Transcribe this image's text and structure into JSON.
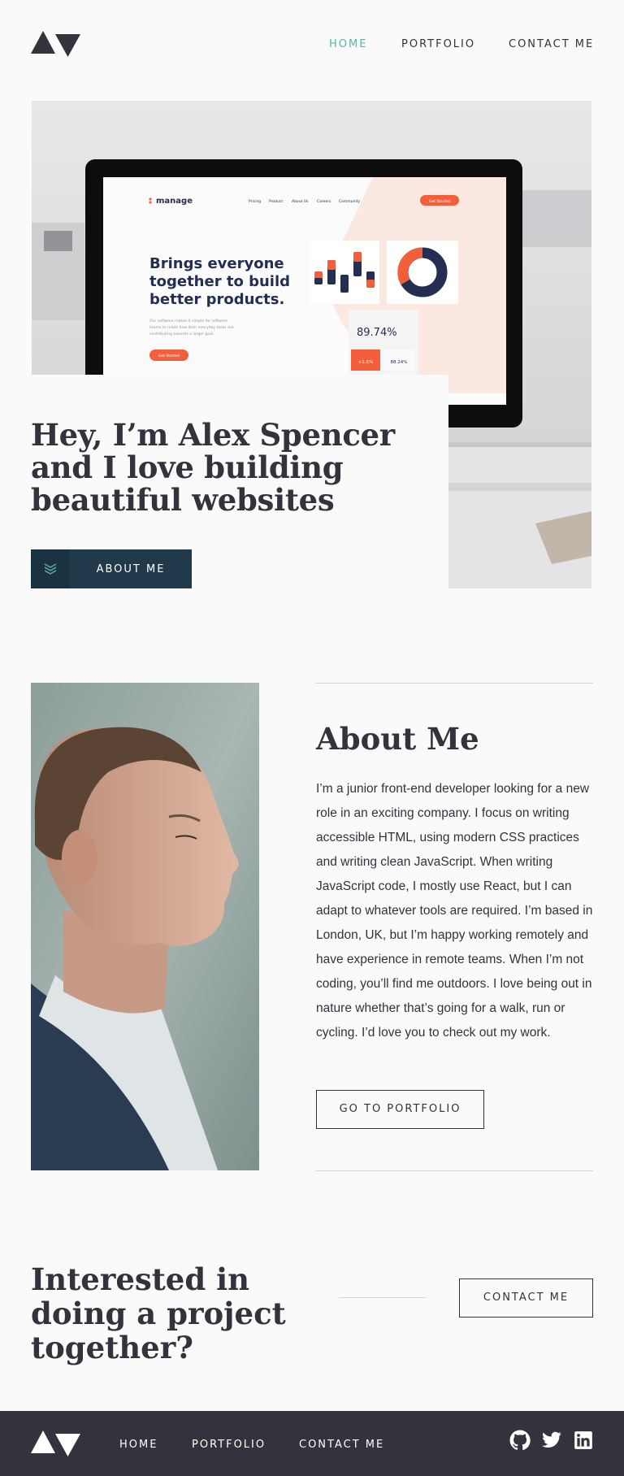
{
  "nav": {
    "home": "HOME",
    "portfolio": "PORTFOLIO",
    "contact": "CONTACT ME"
  },
  "hero": {
    "title": "Hey, I’m Alex Spencer and I love building beautiful websites",
    "button": "ABOUT ME",
    "mockup": {
      "brand": "manage",
      "links": [
        "Pricing",
        "Product",
        "About Us",
        "Careers",
        "Community"
      ],
      "cta": "Get Started",
      "headline_1": "Brings everyone",
      "headline_2": "together to build",
      "headline_3": "better products.",
      "sub_1": "Our software makes it simple for software",
      "sub_2": "teams to relate how their everyday tasks are",
      "sub_3": "contributing towards a larger goal.",
      "button": "Get Started",
      "stat_main": "89.74%",
      "stat_badge": "+1.5%",
      "stat_small": "88.24%"
    }
  },
  "about": {
    "title": "About Me",
    "body": "I’m a junior front-end developer looking for a new role in an exciting company. I focus on writing accessible HTML, using modern CSS practices and writing clean JavaScript. When writing JavaScript code, I mostly use React, but I can adapt to whatever tools are required. I’m based in London, UK, but I’m happy working remotely and have experience in remote teams. When I’m not coding, you’ll find me outdoors. I love being out in nature whether that’s going for a walk, run or cycling. I’d love you to check out my work.",
    "button": "GO TO PORTFOLIO"
  },
  "cta": {
    "title": "Interested in doing a project together?",
    "button": "CONTACT ME"
  },
  "footer": {
    "home": "HOME",
    "portfolio": "PORTFOLIO",
    "contact": "CONTACT ME",
    "social": [
      "github-icon",
      "twitter-icon",
      "linkedin-icon"
    ]
  },
  "colors": {
    "ink": "#33323d",
    "accent": "#5fb4a2",
    "navy": "#203a4c",
    "background": "#fafafa",
    "mockup_orange": "#f25f3a"
  }
}
